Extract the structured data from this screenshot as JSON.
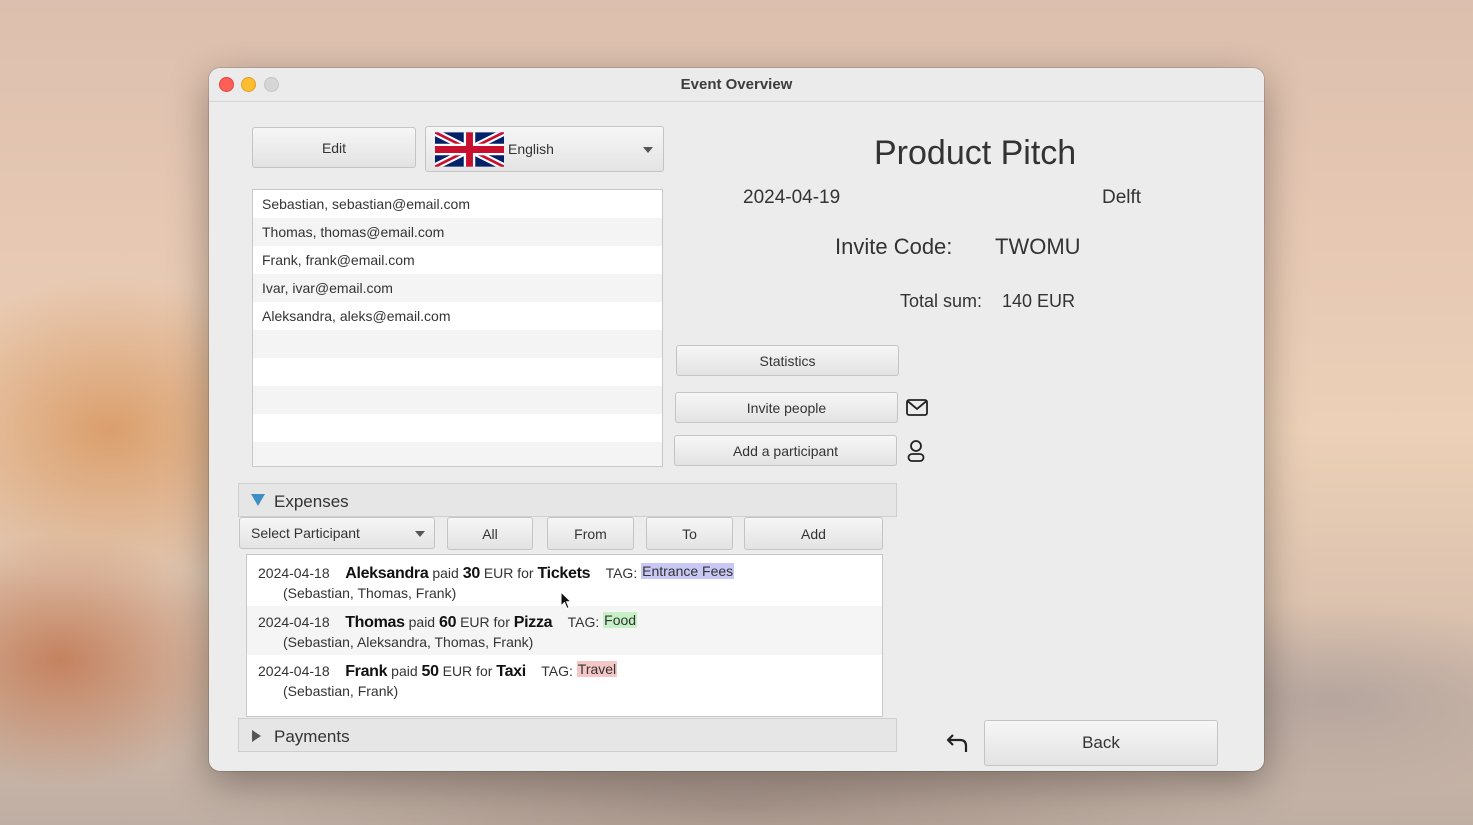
{
  "window": {
    "title": "Event Overview"
  },
  "toolbar": {
    "edit_label": "Edit",
    "language": "English"
  },
  "participants": [
    "Sebastian, sebastian@email.com",
    "Thomas, thomas@email.com",
    "Frank, frank@email.com",
    "Ivar, ivar@email.com",
    "Aleksandra, aleks@email.com"
  ],
  "event": {
    "name": "Product Pitch",
    "date": "2024-04-19",
    "location": "Delft",
    "invite_code_label": "Invite Code:",
    "invite_code": "TWOMU",
    "total_label": "Total sum:",
    "total": "140 EUR"
  },
  "actions": {
    "statistics": "Statistics",
    "invite": "Invite people",
    "add_participant": "Add a participant",
    "back": "Back"
  },
  "expenses": {
    "header": "Expenses",
    "select_placeholder": "Select Participant",
    "filters": {
      "all": "All",
      "from": "From",
      "to": "To",
      "add": "Add"
    },
    "paid_word": "paid",
    "eur_for": "EUR for",
    "tag_label": "TAG:",
    "items": [
      {
        "date": "2024-04-18",
        "payer": "Aleksandra",
        "amount": "30",
        "title": "Tickets",
        "tag": "Entrance Fees",
        "tag_color": "#c9c7f4",
        "debtors": "(Sebastian, Thomas, Frank)"
      },
      {
        "date": "2024-04-18",
        "payer": "Thomas",
        "amount": "60",
        "title": "Pizza",
        "tag": "Food",
        "tag_color": "#c6f0c6",
        "debtors": "(Sebastian, Aleksandra, Thomas, Frank)"
      },
      {
        "date": "2024-04-18",
        "payer": "Frank",
        "amount": "50",
        "title": "Taxi",
        "tag": "Travel",
        "tag_color": "#f4c6c6",
        "debtors": "(Sebastian, Frank)"
      }
    ]
  },
  "payments": {
    "header": "Payments"
  }
}
